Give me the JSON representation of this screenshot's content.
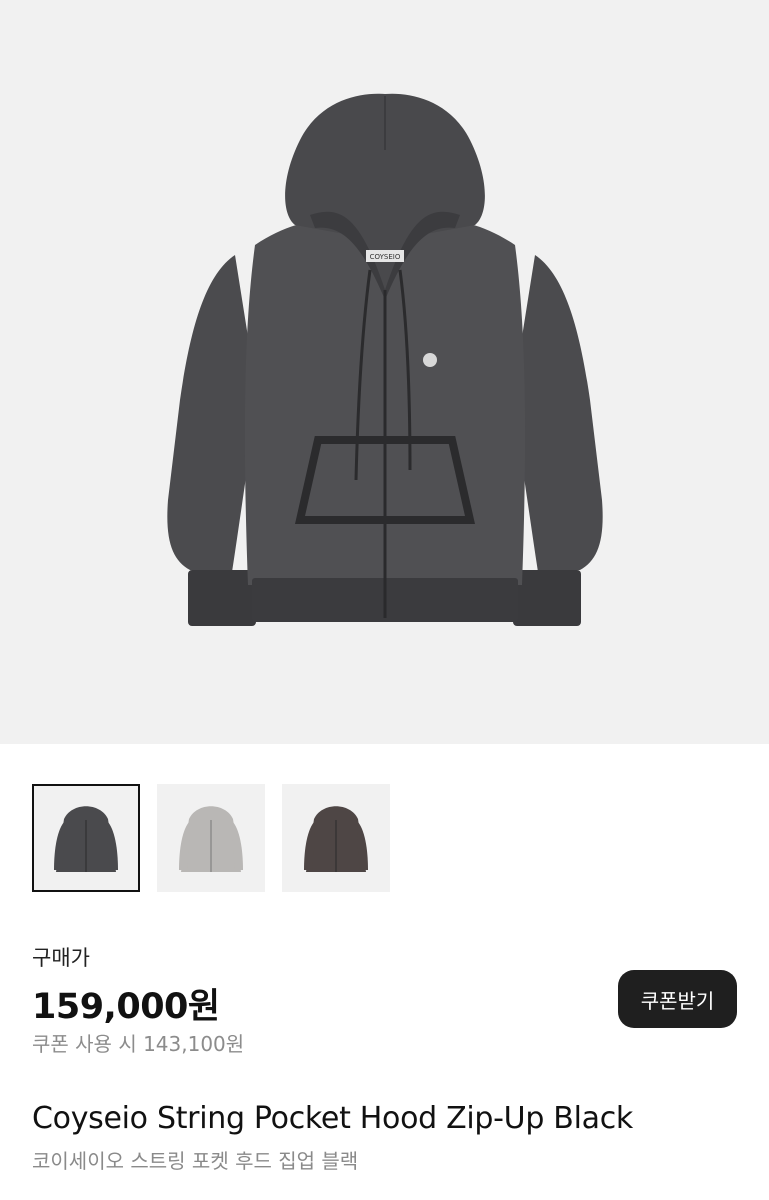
{
  "product": {
    "price_label": "구매가",
    "price": "159,000원",
    "coupon_price_text": "쿠폰 사용 시 143,100원",
    "coupon_button_label": "쿠폰받기",
    "title_en": "Coyseio String Pocket Hood Zip-Up Black",
    "title_ko": "코이세이오 스트링 포켓 후드 집업 블랙",
    "brand_tag": "COYSEIO"
  },
  "thumbnails": [
    {
      "name": "black",
      "color": "#4a4a4d",
      "selected": true
    },
    {
      "name": "gray",
      "color": "#b9b7b5",
      "selected": false
    },
    {
      "name": "brown",
      "color": "#4e4645",
      "selected": false
    }
  ],
  "colors": {
    "hero_background": "#f1f1f1",
    "hoodie_body": "#4b4b4e",
    "hoodie_shadow": "#3b3b3e",
    "button_background": "#1f1f1f",
    "muted_text": "#8c8c8c"
  }
}
